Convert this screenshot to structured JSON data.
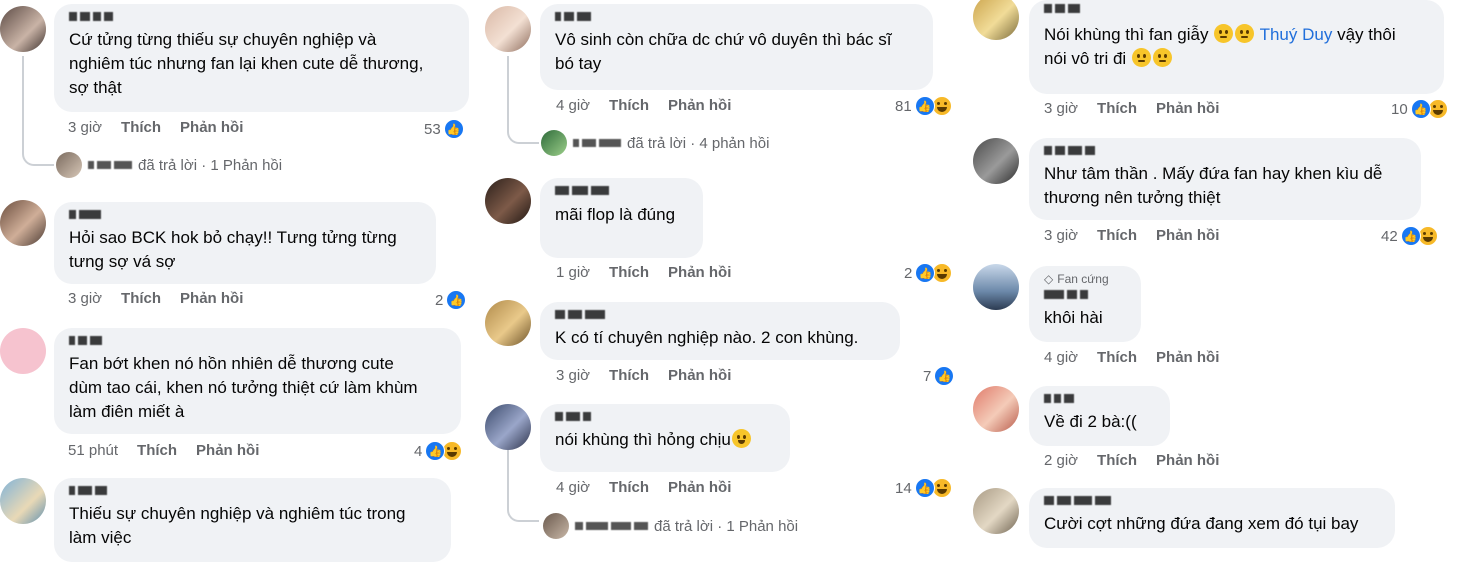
{
  "comments": [
    {
      "text": "Cứ tửng từng thiếu sự chuyên nghiệp và\nnghiêm túc nhưng fan lại khen cute dễ thương,\nsợ thật",
      "time": "3 giờ",
      "like": "Thích",
      "reply": "Phản hồi",
      "count": "53"
    },
    {
      "text": "Hỏi sao BCK hok bỏ chạy!! Tưng tửng từng\ntưng sợ vá sợ",
      "time": "3 giờ",
      "like": "Thích",
      "reply": "Phản hồi",
      "count": "2"
    },
    {
      "text": "Fan bớt khen nó hồn nhiên dễ thương cute\ndùm tao cái, khen nó tưởng thiệt cứ làm khùm\nlàm điên miết à",
      "time": "51 phút",
      "like": "Thích",
      "reply": "Phản hồi",
      "count": "4"
    },
    {
      "text": "Thiếu sự chuyên nghiệp và nghiêm túc trong\nlàm việc"
    },
    {
      "text": "Vô sinh còn chữa dc chứ vô duyên thì bác sĩ\nbó tay",
      "time": "4 giờ",
      "like": "Thích",
      "reply": "Phản hồi",
      "count": "81"
    },
    {
      "text": "mãi flop là đúng",
      "time": "1 giờ",
      "like": "Thích",
      "reply": "Phản hồi",
      "count": "2"
    },
    {
      "text": "K có tí chuyên nghiệp nào. 2 con khùng.",
      "time": "3 giờ",
      "like": "Thích",
      "reply": "Phản hồi",
      "count": "7"
    },
    {
      "text": "nói khùng thì hỏng chịu",
      "time": "4 giờ",
      "like": "Thích",
      "reply": "Phản hồi",
      "count": "14"
    },
    {
      "text_a": "Nói khùng thì fan giẫy ",
      "link": "Thuý Duy",
      "text_b": " vậy thôi",
      "text_c": "nói vô tri đi ",
      "time": "3 giờ",
      "like": "Thích",
      "reply": "Phản hồi",
      "count": "10"
    },
    {
      "text": "Như tâm thần . Mấy đứa fan hay khen kìu dễ\nthương nên tưởng thiệt",
      "time": "3 giờ",
      "like": "Thích",
      "reply": "Phản hồi",
      "count": "42"
    },
    {
      "badge": "Fan cứng",
      "text": "khôi hài",
      "time": "4 giờ",
      "like": "Thích",
      "reply": "Phản hồi"
    },
    {
      "text": "Về đi 2 bà:((",
      "time": "2 giờ",
      "like": "Thích",
      "reply": "Phản hồi"
    },
    {
      "text": "Cười cợt những đứa đang xem đó tụi bay"
    }
  ],
  "replies": [
    {
      "text": "đã trả lời · 1 Phản hồi"
    },
    {
      "text": "đã trả lời · 4 phản hồi"
    },
    {
      "text": "đã trả lời · 1 Phản hồi"
    }
  ],
  "colors": {
    "bubble": "#f0f2f5",
    "meta": "#65676b",
    "like": "#1877f2",
    "link": "#216fdb"
  }
}
